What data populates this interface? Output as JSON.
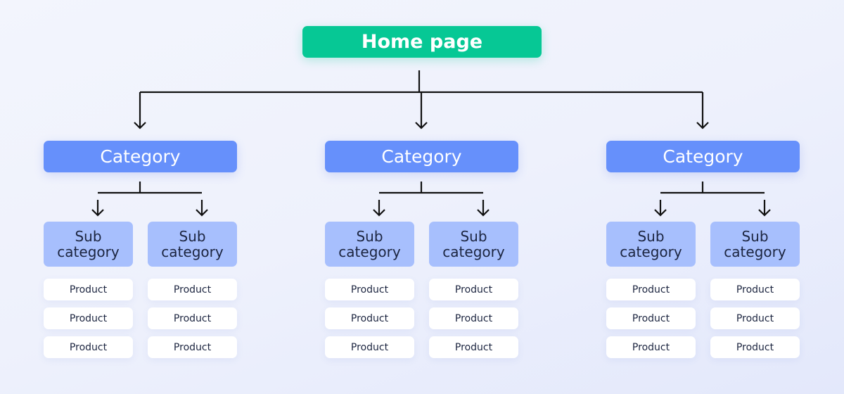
{
  "root": {
    "label": "Home page",
    "color": "#06c895"
  },
  "categories": [
    {
      "label": "Category",
      "subcategories": [
        {
          "label": "Sub category",
          "products": [
            "Product",
            "Product",
            "Product"
          ]
        },
        {
          "label": "Sub category",
          "products": [
            "Product",
            "Product",
            "Product"
          ]
        }
      ]
    },
    {
      "label": "Category",
      "subcategories": [
        {
          "label": "Sub category",
          "products": [
            "Product",
            "Product",
            "Product"
          ]
        },
        {
          "label": "Sub category",
          "products": [
            "Product",
            "Product",
            "Product"
          ]
        }
      ]
    },
    {
      "label": "Category",
      "subcategories": [
        {
          "label": "Sub category",
          "products": [
            "Product",
            "Product",
            "Product"
          ]
        },
        {
          "label": "Sub category",
          "products": [
            "Product",
            "Product",
            "Product"
          ]
        }
      ]
    }
  ],
  "colors": {
    "category": "#6690fb",
    "subcategory": "#a7bffd",
    "product": "#ffffff",
    "connector": "#111111"
  }
}
